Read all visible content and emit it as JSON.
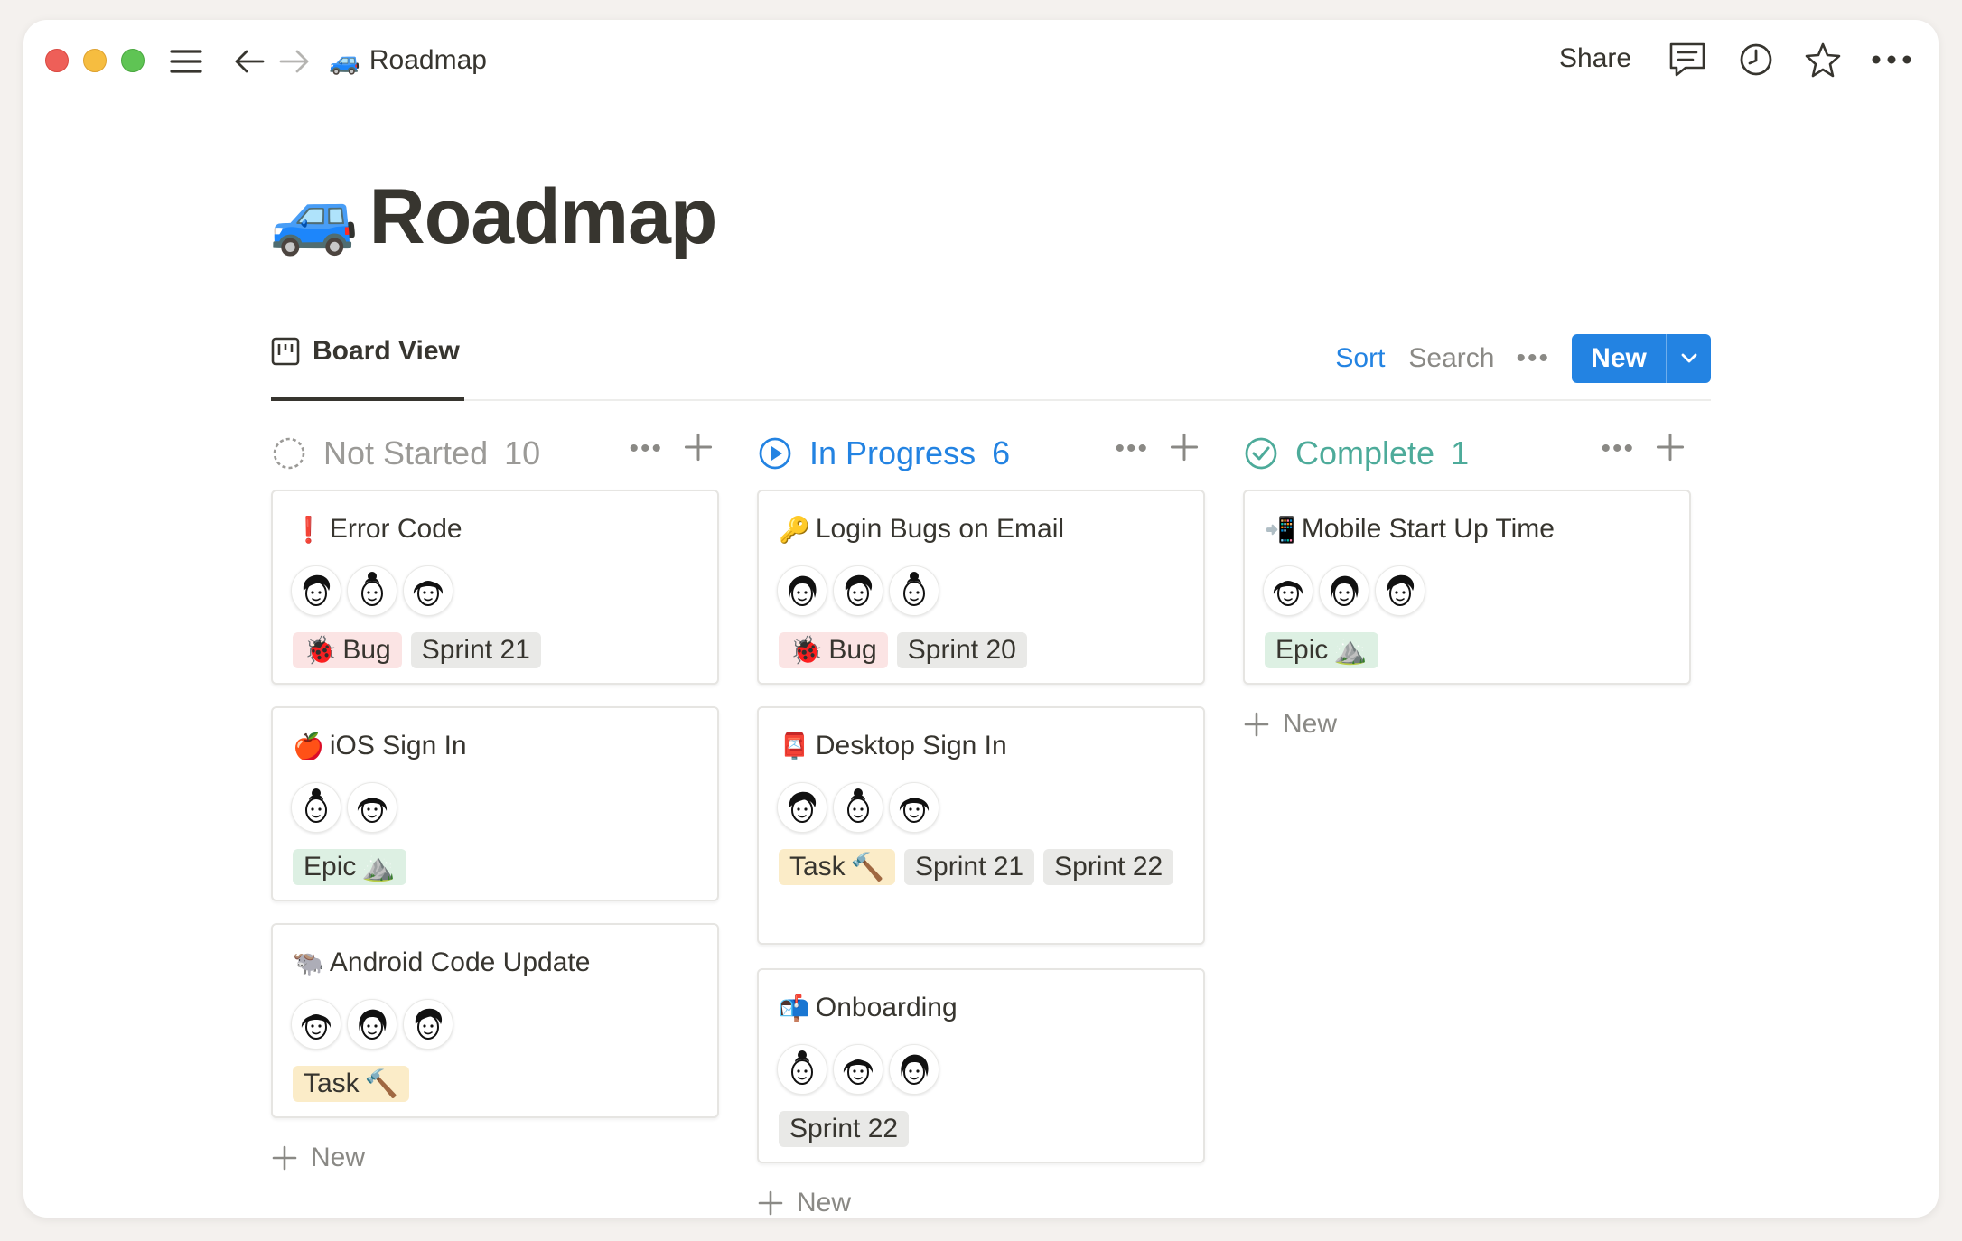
{
  "topbar": {
    "breadcrumb_emoji": "🚙",
    "breadcrumb_title": "Roadmap",
    "share_label": "Share"
  },
  "page": {
    "title_emoji": "🚙",
    "title": "Roadmap"
  },
  "view": {
    "tab_label": "Board View",
    "sort_label": "Sort",
    "search_label": "Search",
    "more_label": "•••",
    "new_label": "New"
  },
  "columns": [
    {
      "title": "Not Started",
      "count": "10",
      "color": "#9b9a97",
      "add_new_label": "New",
      "cards": [
        {
          "emoji": "❗",
          "title": "Error Code",
          "tags": [
            {
              "kind": "bug",
              "emoji": "🐞",
              "label": "Bug"
            },
            {
              "kind": "sprint",
              "label": "Sprint 21"
            }
          ]
        },
        {
          "emoji": "🍎",
          "title": "iOS Sign In",
          "tags": [
            {
              "kind": "epic",
              "label": "Epic",
              "emoji": "⛰️"
            }
          ]
        },
        {
          "emoji": "🐃",
          "title": "Android Code Update",
          "tags": [
            {
              "kind": "task",
              "label": "Task",
              "emoji": "🔨"
            }
          ]
        }
      ]
    },
    {
      "title": "In Progress",
      "count": "6",
      "color": "#2383e2",
      "add_new_label": "New",
      "cards": [
        {
          "emoji": "🔑",
          "title": "Login Bugs on Email",
          "tags": [
            {
              "kind": "bug",
              "emoji": "🐞",
              "label": "Bug"
            },
            {
              "kind": "sprint",
              "label": "Sprint 20"
            }
          ]
        },
        {
          "emoji": "📮",
          "title": "Desktop Sign In",
          "tags": [
            {
              "kind": "task",
              "label": "Task",
              "emoji": "🔨"
            },
            {
              "kind": "sprint",
              "label": "Sprint 21"
            },
            {
              "kind": "sprint",
              "label": "Sprint 22"
            }
          ]
        },
        {
          "emoji": "📬",
          "title": "Onboarding",
          "tags": [
            {
              "kind": "sprint",
              "label": "Sprint 22"
            }
          ]
        }
      ]
    },
    {
      "title": "Complete",
      "count": "1",
      "color": "#4dab9a",
      "add_new_label": "New",
      "cards": [
        {
          "emoji": "📲",
          "title": "Mobile Start Up Time",
          "tags": [
            {
              "kind": "epic",
              "label": "Epic",
              "emoji": "⛰️"
            }
          ]
        }
      ]
    }
  ]
}
